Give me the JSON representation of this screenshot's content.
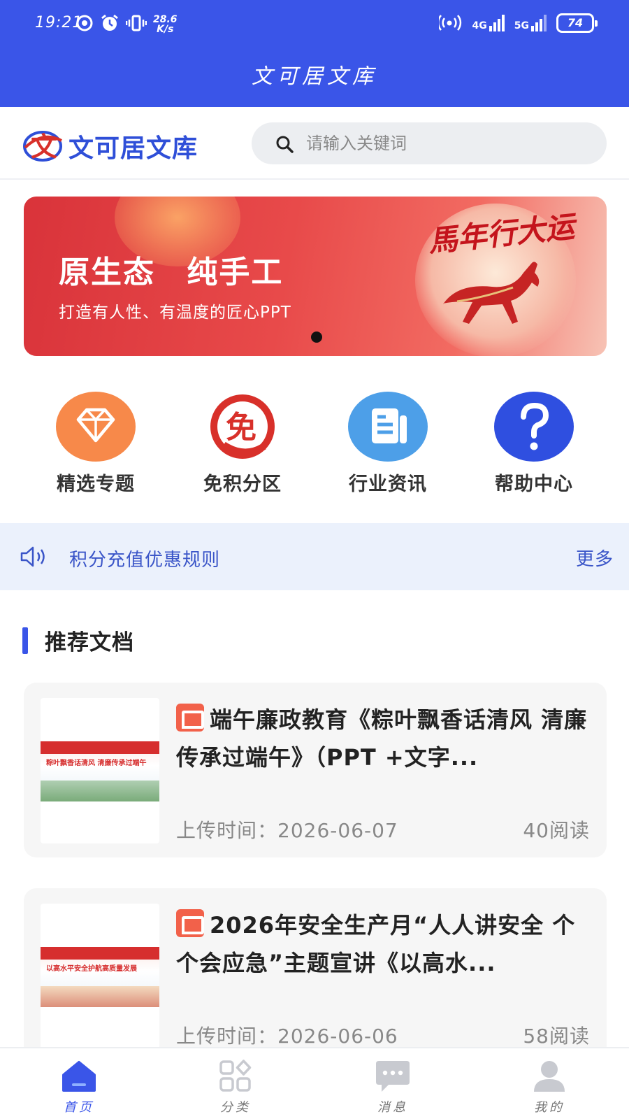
{
  "status_bar": {
    "time": "19:21",
    "network_speed_value": "28.6",
    "network_speed_unit": "K/s",
    "signal_1": "4G",
    "signal_2": "5G",
    "battery": "74"
  },
  "app_bar": {
    "title": "文可居文库"
  },
  "header": {
    "brand_name": "文可居文库",
    "logo_glyph": "文",
    "search_placeholder": "请输入关键词"
  },
  "banner": {
    "headline": "原生态 纯手工",
    "subheadline": "打造有人性、有温度的匠心PPT",
    "calligraphy": "馬年行大运",
    "slide_count": 1,
    "active_slide": 1
  },
  "quick_entries": [
    {
      "label": "精选专题",
      "icon": "diamond-icon",
      "color": "#f7894a"
    },
    {
      "label": "免积分区",
      "icon": "free-badge-icon",
      "color": "#d8302a"
    },
    {
      "label": "行业资讯",
      "icon": "news-document-icon",
      "color": "#4d9fe8"
    },
    {
      "label": "帮助中心",
      "icon": "question-mark-icon",
      "color": "#2f4fe0"
    }
  ],
  "notice": {
    "text": "积分充值优惠规则",
    "more": "更多",
    "icon": "speaker-icon"
  },
  "recommended": {
    "section_title": "推荐文档",
    "docs": [
      {
        "title": "端午廉政教育《粽叶飘香话清风 清廉传承过端午》（PPT +文字...",
        "thumb_caption": "粽叶飘香话清风 清廉传承过端午",
        "upload_label": "上传时间：",
        "upload_date": "2026-06-07",
        "reads": "40阅读",
        "file_icon": "ppt-file-icon"
      },
      {
        "title": "2026年安全生产月“人人讲安全 个个会应急”主题宣讲《以高水...",
        "thumb_caption": "以高水平安全护航高质量发展",
        "upload_label": "上传时间：",
        "upload_date": "2026-06-06",
        "reads": "58阅读",
        "file_icon": "ppt-file-icon"
      }
    ]
  },
  "tab_bar": {
    "items": [
      {
        "label": "首页",
        "icon": "home-icon",
        "active": true
      },
      {
        "label": "分类",
        "icon": "category-grid-icon",
        "active": false
      },
      {
        "label": "消息",
        "icon": "message-icon",
        "active": false
      },
      {
        "label": "我的",
        "icon": "user-icon",
        "active": false
      }
    ],
    "active_color": "#3a55e8",
    "inactive_color": "#c8cad0"
  },
  "colors": {
    "primary": "#3a55e8",
    "notice_bg": "#ebf1fc",
    "card_bg": "#f6f6f6"
  }
}
